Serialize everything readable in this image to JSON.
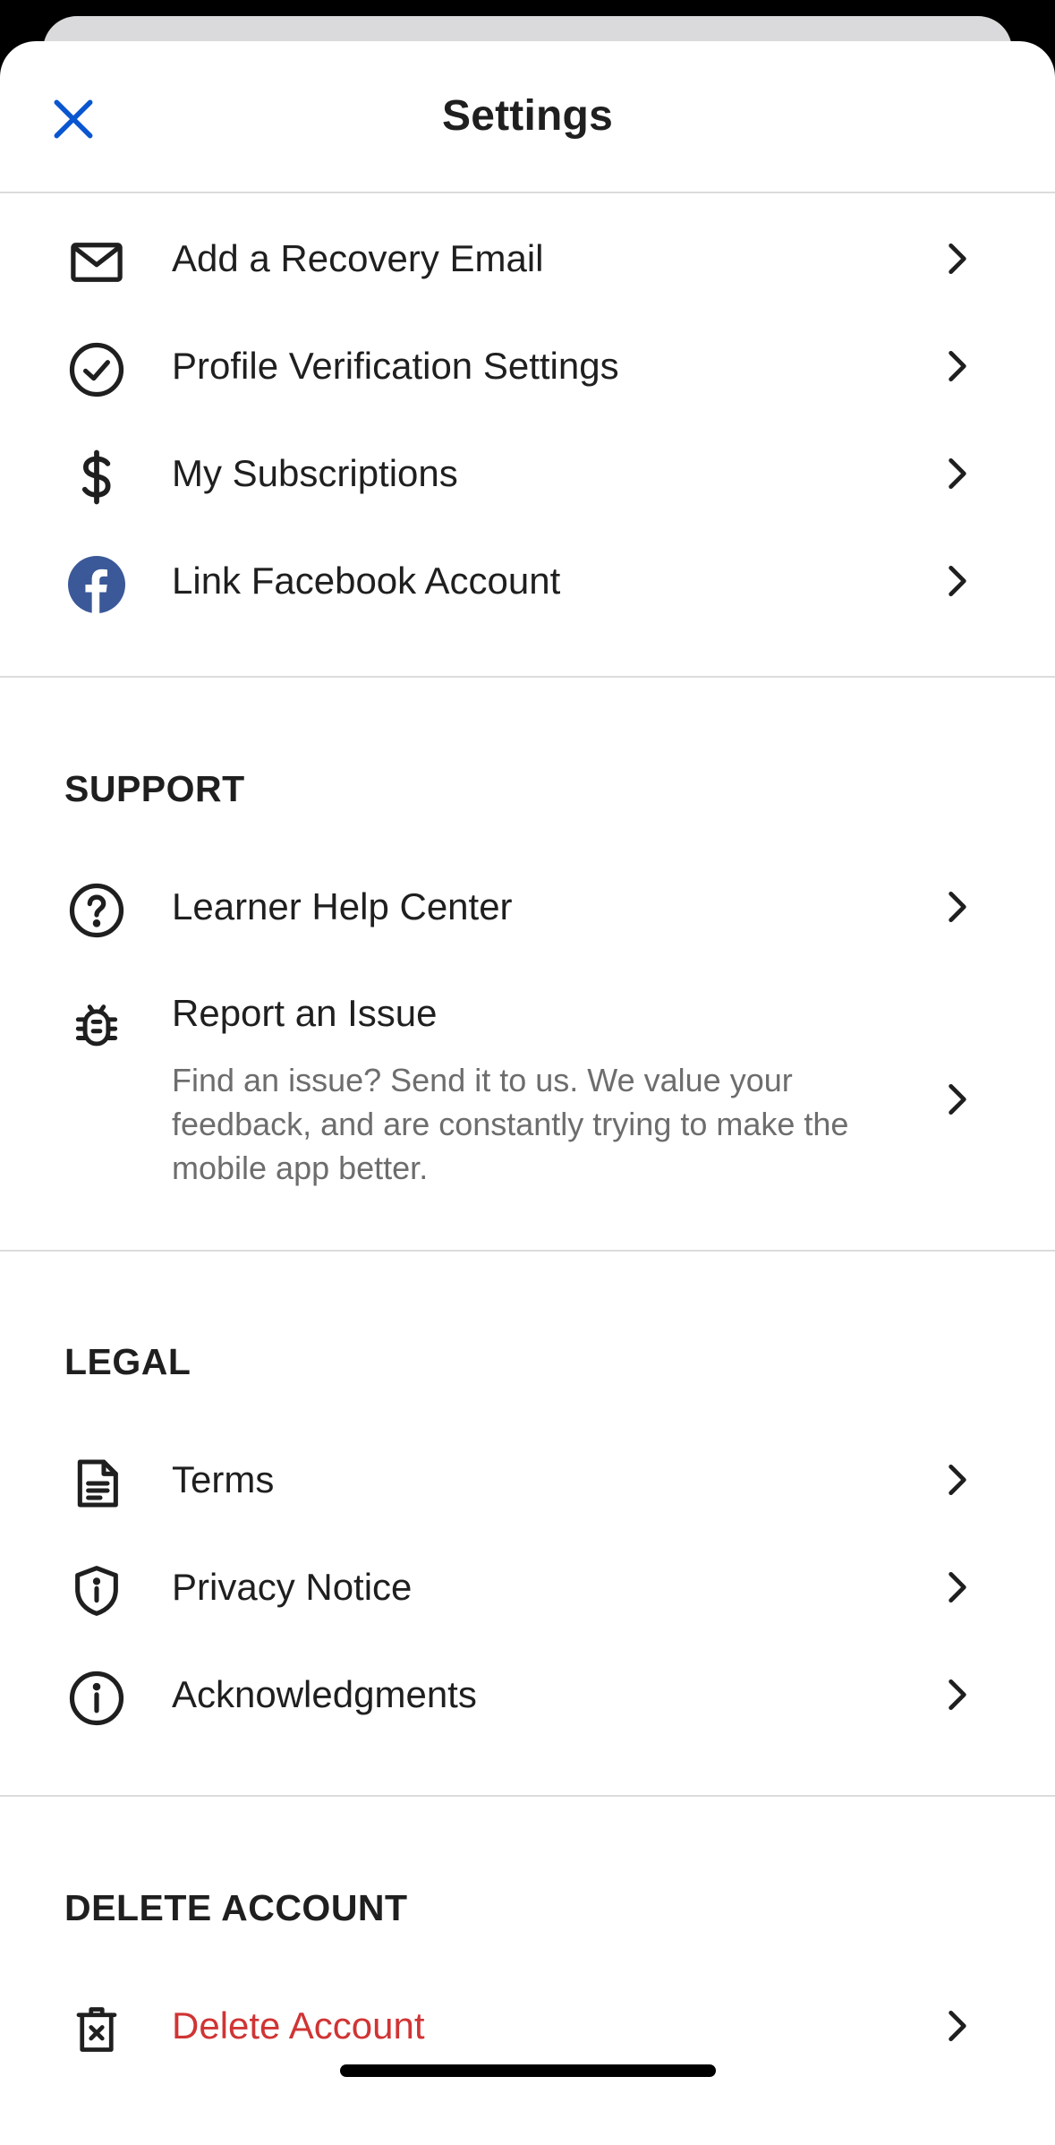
{
  "header": {
    "title": "Settings"
  },
  "account": {
    "items": [
      {
        "label": "Add a Recovery Email",
        "icon": "mail-icon"
      },
      {
        "label": "Profile Verification Settings",
        "icon": "check-circle-icon"
      },
      {
        "label": "My Subscriptions",
        "icon": "dollar-icon"
      },
      {
        "label": "Link Facebook Account",
        "icon": "facebook-icon"
      }
    ]
  },
  "support": {
    "title": "SUPPORT",
    "items": [
      {
        "label": "Learner Help Center",
        "icon": "help-circle-icon"
      },
      {
        "label": "Report an Issue",
        "icon": "bug-icon",
        "description": "Find an issue? Send it to us. We value your feedback, and are constantly trying to make the mobile app better."
      }
    ]
  },
  "legal": {
    "title": "LEGAL",
    "items": [
      {
        "label": "Terms",
        "icon": "document-icon"
      },
      {
        "label": "Privacy Notice",
        "icon": "shield-info-icon"
      },
      {
        "label": "Acknowledgments",
        "icon": "info-circle-icon"
      }
    ]
  },
  "delete_account": {
    "title": "DELETE ACCOUNT",
    "items": [
      {
        "label": "Delete Account",
        "icon": "trash-icon"
      }
    ]
  },
  "colors": {
    "accent": "#0a56d0",
    "danger": "#d03434",
    "facebook": "#3b5998",
    "text": "#1f1f1f",
    "secondary_text": "#6d6d6d",
    "divider": "#dcdcdc"
  }
}
